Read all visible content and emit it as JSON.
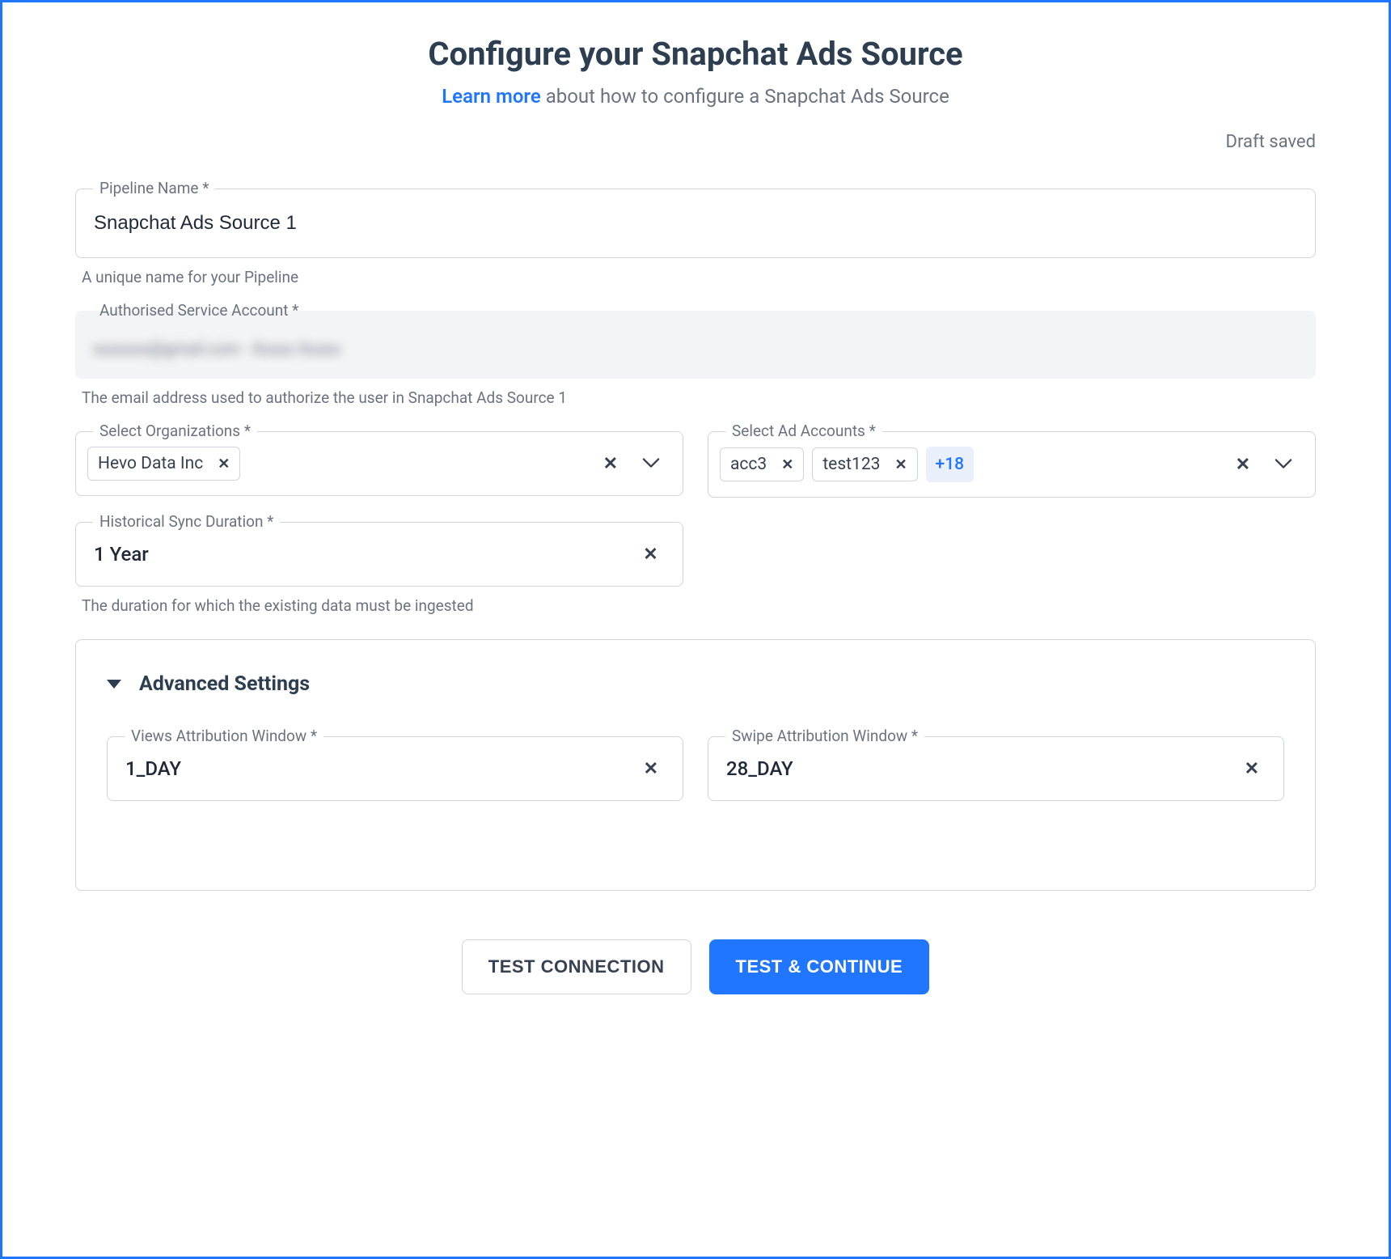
{
  "header": {
    "title": "Configure your Snapchat Ads Source",
    "learn_more": "Learn more",
    "subtitle_rest": " about how to configure a Snapchat Ads Source"
  },
  "status": {
    "draft_saved": "Draft saved"
  },
  "pipeline_name": {
    "label": "Pipeline Name *",
    "value": "Snapchat Ads Source 1",
    "helper": "A unique name for your Pipeline"
  },
  "service_account": {
    "label": "Authorised Service Account *",
    "value_blurred": "xxxxxxx@gmail.com - Xxxxx Xxxxx",
    "helper": "The email address used to authorize the user in Snapchat Ads Source 1"
  },
  "organizations": {
    "label": "Select Organizations *",
    "chips": [
      "Hevo Data Inc"
    ]
  },
  "ad_accounts": {
    "label": "Select Ad Accounts *",
    "chips": [
      "acc3",
      "test123"
    ],
    "more_count": "+18"
  },
  "historical_sync": {
    "label": "Historical Sync Duration *",
    "value": "1 Year",
    "helper": "The duration for which the existing data must be ingested"
  },
  "advanced": {
    "title": "Advanced Settings",
    "views_attr": {
      "label": "Views Attribution Window *",
      "value": "1_DAY"
    },
    "swipe_attr": {
      "label": "Swipe Attribution Window *",
      "value": "28_DAY"
    }
  },
  "buttons": {
    "test_connection": "TEST CONNECTION",
    "test_continue": "TEST & CONTINUE"
  }
}
